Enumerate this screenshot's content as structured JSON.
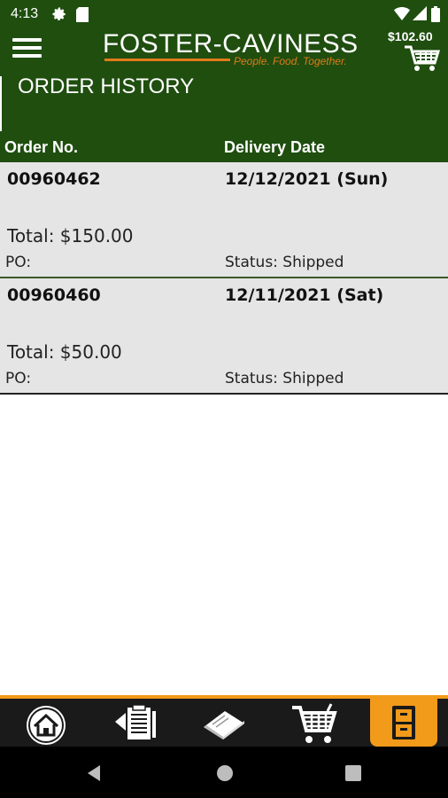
{
  "status_bar": {
    "time": "4:13",
    "icons": [
      "gear-icon",
      "sd-card-icon",
      "wifi-icon",
      "signal-icon",
      "battery-icon"
    ]
  },
  "header": {
    "menu_icon": "hamburger-menu-icon",
    "logo_text": "FOSTER-CAVINESS",
    "logo_tagline": "People. Food. Together.",
    "cart_total": "$102.60",
    "cart_icon": "cart-icon"
  },
  "page": {
    "title": "ORDER HISTORY",
    "columns": {
      "order_no": "Order No.",
      "delivery_date": "Delivery Date"
    }
  },
  "orders": [
    {
      "order_no": "00960462",
      "delivery_date": "12/12/2021 (Sun)",
      "total": "Total: $150.00",
      "po": "PO:",
      "status": "Status: Shipped"
    },
    {
      "order_no": "00960460",
      "delivery_date": "12/11/2021 (Sat)",
      "total": "Total: $50.00",
      "po": "PO:",
      "status": "Status: Shipped"
    }
  ],
  "bottom_nav": {
    "items": [
      "home-icon",
      "order-guide-icon",
      "catalog-icon",
      "cart-icon",
      "order-history-icon"
    ],
    "active": "order-history-icon"
  },
  "system_nav": {
    "icons": [
      "back-icon",
      "home-circle-icon",
      "recents-icon"
    ]
  },
  "colors": {
    "header_green": "#1f4e0f",
    "accent_orange": "#f29a1a",
    "card_gray": "#e5e5e5"
  }
}
